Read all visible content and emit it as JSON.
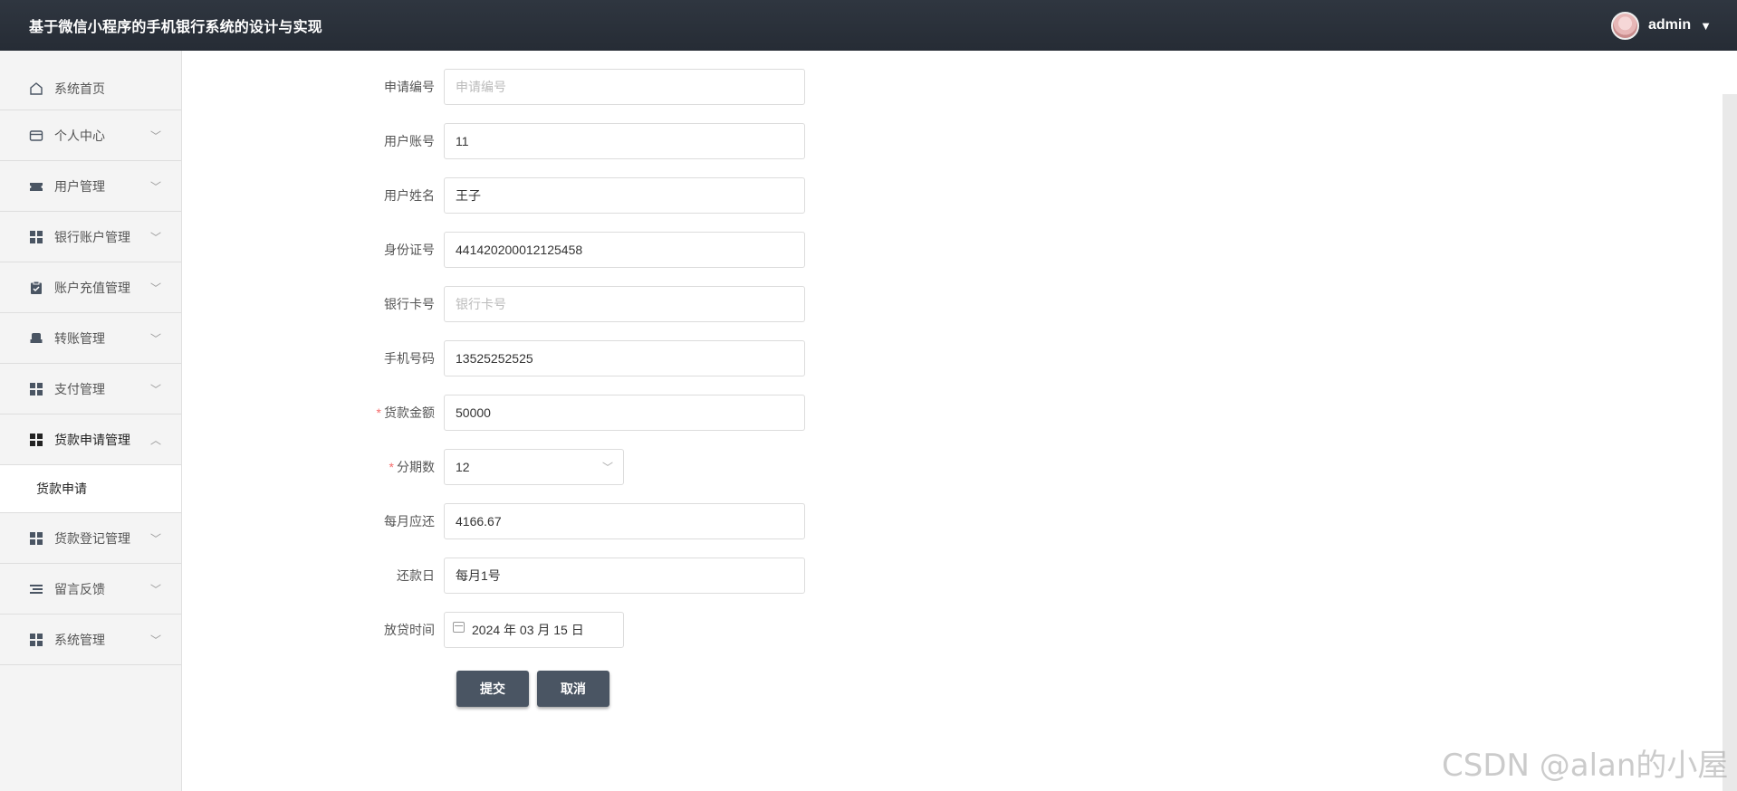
{
  "header": {
    "title": "基于微信小程序的手机银行系统的设计与实现",
    "user": "admin"
  },
  "sidebar": {
    "items": [
      {
        "label": "系统首页",
        "icon": "home-icon"
      },
      {
        "label": "个人中心",
        "icon": "card-icon"
      },
      {
        "label": "用户管理",
        "icon": "ticket-icon"
      },
      {
        "label": "银行账户管理",
        "icon": "grid-icon"
      },
      {
        "label": "账户充值管理",
        "icon": "clipboard-icon"
      },
      {
        "label": "转账管理",
        "icon": "printer-icon"
      },
      {
        "label": "支付管理",
        "icon": "grid-icon"
      },
      {
        "label": "货款申请管理",
        "icon": "grid-icon"
      },
      {
        "label": "货款登记管理",
        "icon": "grid-icon"
      },
      {
        "label": "留言反馈",
        "icon": "list-icon"
      },
      {
        "label": "系统管理",
        "icon": "grid-icon"
      }
    ],
    "submenu": {
      "label": "货款申请"
    }
  },
  "form": {
    "application_no": {
      "label": "申请编号",
      "value": "",
      "placeholder": "申请编号"
    },
    "user_account": {
      "label": "用户账号",
      "value": "11"
    },
    "user_name": {
      "label": "用户姓名",
      "value": "王子"
    },
    "id_number": {
      "label": "身份证号",
      "value": "441420200012125458"
    },
    "bank_card": {
      "label": "银行卡号",
      "value": "",
      "placeholder": "银行卡号"
    },
    "phone": {
      "label": "手机号码",
      "value": "13525252525"
    },
    "loan_amount": {
      "label": "货款金额",
      "value": "50000"
    },
    "installments": {
      "label": "分期数",
      "value": "12"
    },
    "monthly_payment": {
      "label": "每月应还",
      "value": "4166.67"
    },
    "repay_day": {
      "label": "还款日",
      "value": "每月1号"
    },
    "loan_date": {
      "label": "放贷时间",
      "value": "2024 年 03 月 15 日"
    }
  },
  "actions": {
    "submit": "提交",
    "cancel": "取消"
  },
  "watermark": "CSDN @alan的小屋"
}
